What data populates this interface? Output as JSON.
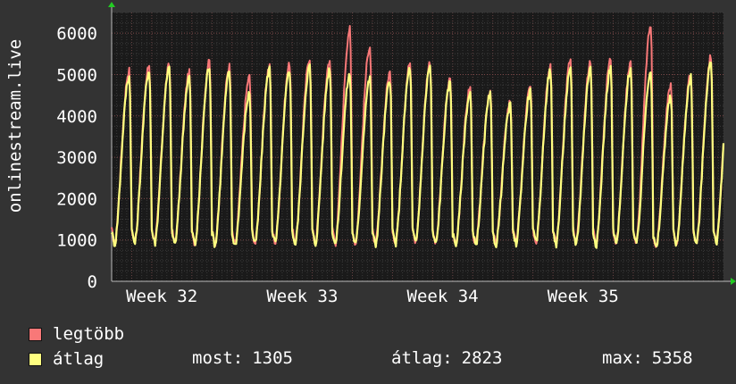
{
  "chart_data": {
    "type": "line",
    "ylabel": "onlinestream.live",
    "ylim": [
      0,
      6500
    ],
    "yticks": [
      0,
      1000,
      2000,
      3000,
      4000,
      5000,
      6000
    ],
    "x_ticks": [
      {
        "label": "Week 32",
        "day": 2.5
      },
      {
        "label": "Week 33",
        "day": 9.5
      },
      {
        "label": "Week 34",
        "day": 16.5
      },
      {
        "label": "Week 35",
        "day": 23.5
      }
    ],
    "x_range_days": [
      0,
      30.5
    ],
    "series": [
      {
        "name": "legtöbb",
        "color": "#f87878",
        "daily_peaks": [
          5100,
          5230,
          5220,
          5050,
          5310,
          5200,
          4950,
          5220,
          5260,
          5400,
          5360,
          6100,
          5700,
          5050,
          5280,
          5300,
          4880,
          4670,
          4620,
          4350,
          4700,
          5250,
          5350,
          5320,
          5380,
          5310,
          6180,
          4750,
          5000,
          5420,
          5450
        ],
        "daily_mins": [
          900,
          920,
          930,
          910,
          900,
          880,
          870,
          900,
          920,
          900,
          900,
          910,
          890,
          880,
          910,
          920,
          900,
          890,
          880,
          900,
          910,
          920,
          900,
          910,
          890,
          900,
          880,
          820,
          890,
          900,
          950
        ]
      },
      {
        "name": "átlag",
        "color": "#ffff80",
        "daily_peaks": [
          4950,
          5100,
          5150,
          4950,
          5200,
          5050,
          4550,
          5150,
          5100,
          5200,
          5150,
          5000,
          4900,
          4850,
          5150,
          5200,
          4800,
          4550,
          4500,
          4250,
          4600,
          5100,
          5100,
          5150,
          5150,
          5150,
          5100,
          4450,
          4950,
          5300,
          5320
        ],
        "daily_mins": [
          880,
          900,
          910,
          890,
          880,
          860,
          850,
          880,
          900,
          880,
          880,
          890,
          870,
          860,
          890,
          900,
          880,
          870,
          860,
          880,
          890,
          900,
          880,
          890,
          870,
          880,
          860,
          780,
          870,
          880,
          930
        ]
      }
    ],
    "grid": true,
    "legend_placement": "bottom-left"
  },
  "legend": {
    "items": [
      {
        "label": "legtöbb",
        "color": "#f87878"
      },
      {
        "label": "átlag",
        "color": "#ffff80"
      }
    ]
  },
  "stats": {
    "most_label": "most:",
    "most_value": "1305",
    "atlag_label": "átlag:",
    "atlag_value": "2823",
    "max_label": "max:",
    "max_value": "5358"
  }
}
